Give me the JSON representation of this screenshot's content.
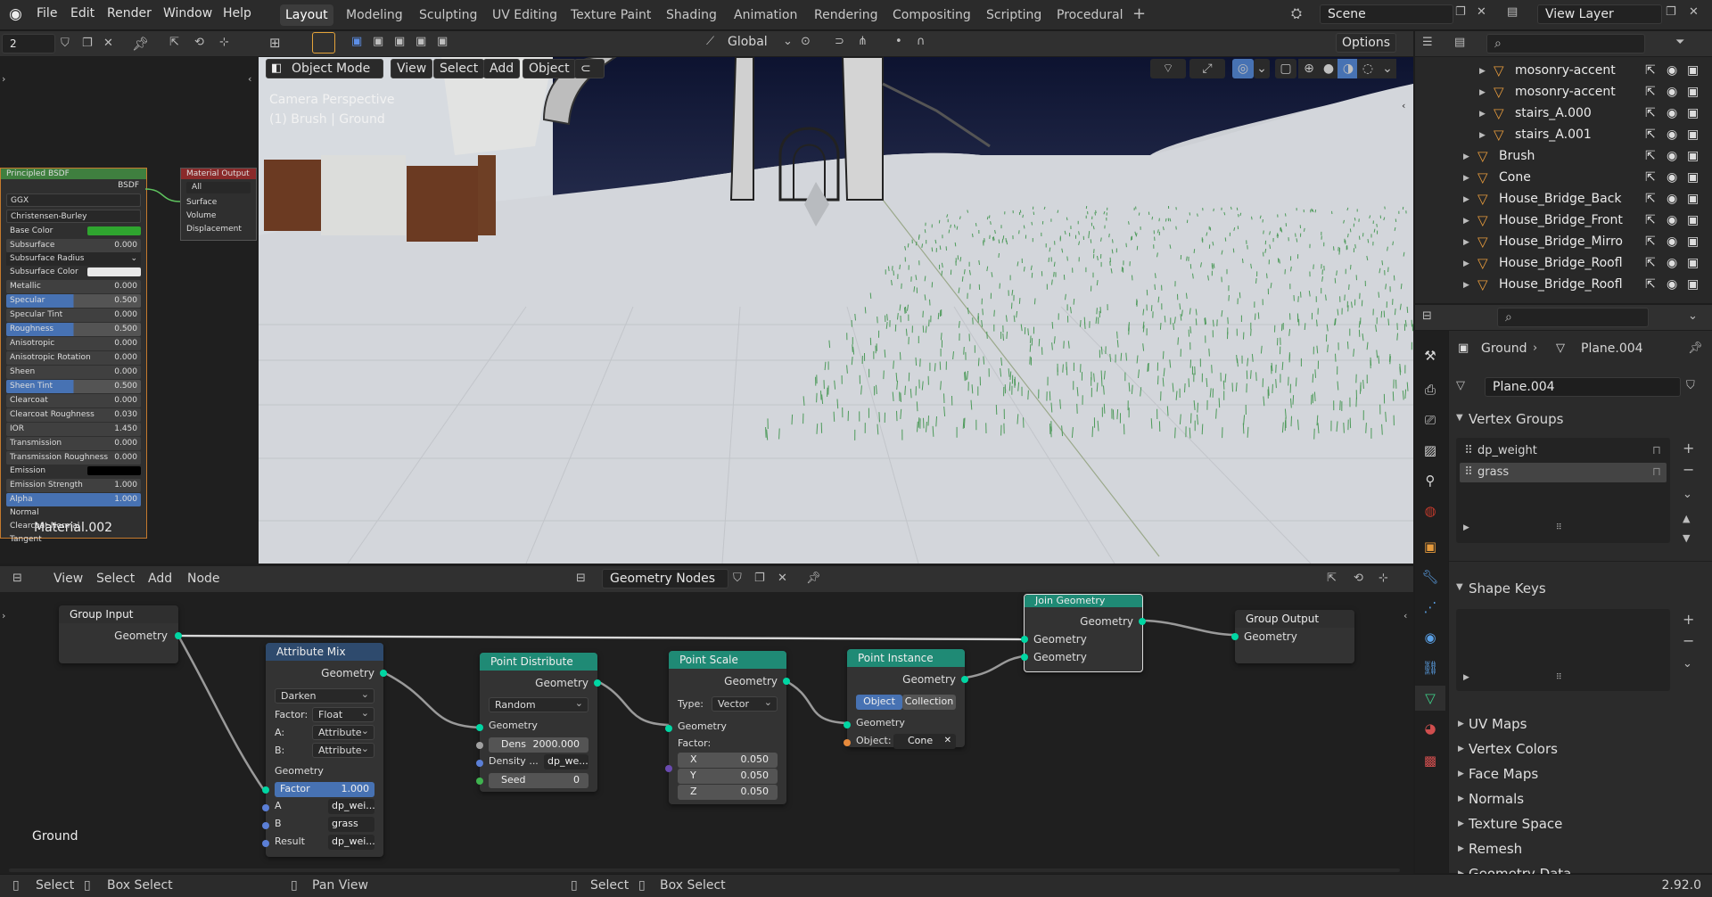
{
  "menu": {
    "file": "File",
    "edit": "Edit",
    "render": "Render",
    "window": "Window",
    "help": "Help"
  },
  "workspaces": [
    "Layout",
    "Modeling",
    "Sculpting",
    "UV Editing",
    "Texture Paint",
    "Shading",
    "Animation",
    "Rendering",
    "Compositing",
    "Scripting",
    "Procedural"
  ],
  "active_workspace": "Layout",
  "scene": "Scene",
  "view_layer": "View Layer",
  "left_field": "2",
  "viewport": {
    "transform_orientation": "Global",
    "options": "Options",
    "mode": "Object Mode",
    "menus": [
      "View",
      "Select",
      "Add",
      "Object"
    ],
    "overlay_line1": "Camera Perspective",
    "overlay_line2": "(1) Brush | Ground"
  },
  "material_nodes": {
    "bsdf_title": "Principled BSDF",
    "bsdf_out": "BSDF",
    "distribution": "GGX",
    "subsurface_method": "Christensen-Burley",
    "rows": [
      {
        "label": "Base Color",
        "value": "",
        "type": "color",
        "color": "#2fa52f"
      },
      {
        "label": "Subsurface",
        "value": "0.000",
        "type": "num"
      },
      {
        "label": "Subsurface Radius",
        "value": "",
        "type": "select"
      },
      {
        "label": "Subsurface Color",
        "value": "",
        "type": "color",
        "color": "#e8e8e8"
      },
      {
        "label": "Metallic",
        "value": "0.000",
        "type": "num"
      },
      {
        "label": "Specular",
        "value": "0.500",
        "type": "slider"
      },
      {
        "label": "Specular Tint",
        "value": "0.000",
        "type": "num"
      },
      {
        "label": "Roughness",
        "value": "0.500",
        "type": "slider"
      },
      {
        "label": "Anisotropic",
        "value": "0.000",
        "type": "num"
      },
      {
        "label": "Anisotropic Rotation",
        "value": "0.000",
        "type": "num"
      },
      {
        "label": "Sheen",
        "value": "0.000",
        "type": "num"
      },
      {
        "label": "Sheen Tint",
        "value": "0.500",
        "type": "slider"
      },
      {
        "label": "Clearcoat",
        "value": "0.000",
        "type": "num"
      },
      {
        "label": "Clearcoat Roughness",
        "value": "0.030",
        "type": "num"
      },
      {
        "label": "IOR",
        "value": "1.450",
        "type": "num"
      },
      {
        "label": "Transmission",
        "value": "0.000",
        "type": "num"
      },
      {
        "label": "Transmission Roughness",
        "value": "0.000",
        "type": "num"
      },
      {
        "label": "Emission",
        "value": "",
        "type": "color",
        "color": "#000000"
      },
      {
        "label": "Emission Strength",
        "value": "1.000",
        "type": "num"
      },
      {
        "label": "Alpha",
        "value": "1.000",
        "type": "slider"
      },
      {
        "label": "Normal",
        "value": "",
        "type": "plain"
      },
      {
        "label": "Clearcoat Normal",
        "value": "",
        "type": "plain"
      },
      {
        "label": "Tangent",
        "value": "",
        "type": "plain"
      }
    ],
    "material_name": "Material.002",
    "output_title": "Material Output",
    "output_target": "All",
    "output_inputs": [
      "Surface",
      "Volume",
      "Displacement"
    ]
  },
  "node_editor": {
    "menus": [
      "View",
      "Select",
      "Add",
      "Node"
    ],
    "tree_name": "Geometry Nodes",
    "object_label": "Ground",
    "group_input": {
      "title": "Group Input",
      "out": "Geometry"
    },
    "attribute_mix": {
      "title": "Attribute Mix",
      "out": "Geometry",
      "blend": "Darken",
      "factor_label": "Factor:",
      "factor_type": "Float",
      "a_label": "A:",
      "a_type": "Attribute",
      "b_label": "B:",
      "b_type": "Attribute",
      "in_geom": "Geometry",
      "factor_name": "Factor",
      "factor_value": "1.000",
      "a_name": "A",
      "a_value": "dp_wei...",
      "b_name": "B",
      "b_value": "grass",
      "result_name": "Result",
      "result_value": "dp_wei..."
    },
    "point_distribute": {
      "title": "Point Distribute",
      "out": "Geometry",
      "mode": "Random",
      "in_geom": "Geometry",
      "dens_label": "Dens",
      "dens_value": "2000.000",
      "density_label": "Density ...",
      "density_value": "dp_we...",
      "seed_label": "Seed",
      "seed_value": "0"
    },
    "point_scale": {
      "title": "Point Scale",
      "out": "Geometry",
      "type_label": "Type:",
      "type_value": "Vector",
      "in_geom": "Geometry",
      "factor_label": "Factor:",
      "x_label": "X",
      "x_value": "0.050",
      "y_label": "Y",
      "y_value": "0.050",
      "z_label": "Z",
      "z_value": "0.050"
    },
    "point_instance": {
      "title": "Point Instance",
      "out": "Geometry",
      "opt_object": "Object",
      "opt_collection": "Collection",
      "in_geom": "Geometry",
      "object_label": "Object:",
      "object_value": "Cone"
    },
    "join_geometry": {
      "title": "Join Geometry",
      "out": "Geometry",
      "in1": "Geometry",
      "in2": "Geometry"
    },
    "group_output": {
      "title": "Group Output",
      "in": "Geometry"
    }
  },
  "outliner": {
    "rows": [
      {
        "name": "mosonry-accent",
        "indent": 1
      },
      {
        "name": "mosonry-accent",
        "indent": 1
      },
      {
        "name": "stairs_A.000",
        "indent": 1
      },
      {
        "name": "stairs_A.001",
        "indent": 1
      },
      {
        "name": "Brush",
        "indent": 0
      },
      {
        "name": "Cone",
        "indent": 0
      },
      {
        "name": "House_Bridge_Back",
        "indent": 0
      },
      {
        "name": "House_Bridge_Front",
        "indent": 0
      },
      {
        "name": "House_Bridge_Mirro",
        "indent": 0
      },
      {
        "name": "House_Bridge_Roofl",
        "indent": 0
      },
      {
        "name": "House_Bridge_Roofl",
        "indent": 0
      }
    ]
  },
  "properties": {
    "breadcrumb_object": "Ground",
    "breadcrumb_data": "Plane.004",
    "mesh_name": "Plane.004",
    "vertex_groups_title": "Vertex Groups",
    "vertex_groups": [
      "dp_weight",
      "grass"
    ],
    "shape_keys_title": "Shape Keys",
    "sections": [
      "UV Maps",
      "Vertex Colors",
      "Face Maps",
      "Normals",
      "Texture Space",
      "Remesh",
      "Geometry Data"
    ]
  },
  "statusbar": {
    "items": [
      "Select",
      "Box Select",
      "Pan View",
      "Select",
      "Box Select"
    ],
    "version": "2.92.0"
  }
}
